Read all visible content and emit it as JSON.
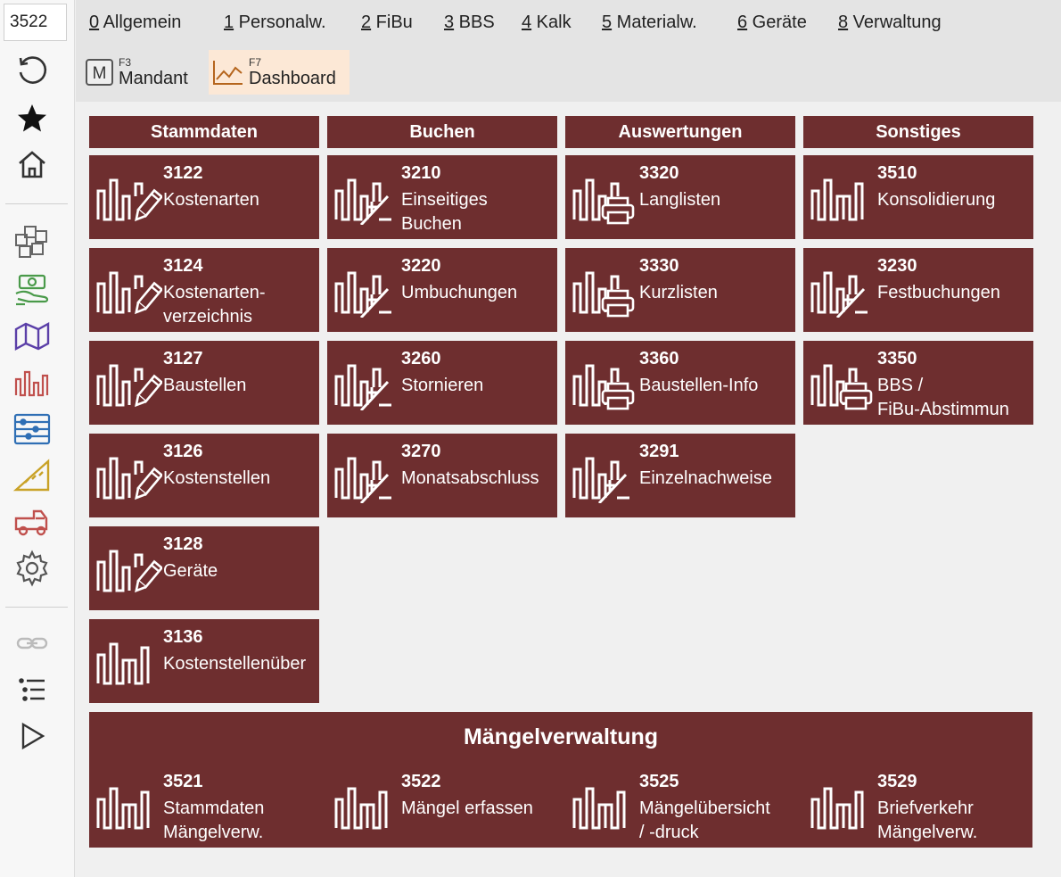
{
  "sidebar": {
    "code_input": "3522",
    "icons": [
      "refresh-icon",
      "star-icon",
      "home-icon",
      "modules-icon",
      "money-icon",
      "map-icon",
      "chart-icon",
      "abacus-icon",
      "stairs-icon",
      "truck-icon",
      "gear-icon",
      "link-icon",
      "list-icon",
      "play-icon"
    ]
  },
  "menu": {
    "items": [
      {
        "key": "0",
        "label": " Allgemein"
      },
      {
        "key": "1",
        "label": " Personalw."
      },
      {
        "key": "2",
        "label": " FiBu"
      },
      {
        "key": "3",
        "label": " BBS"
      },
      {
        "key": "4",
        "label": " Kalk"
      },
      {
        "key": "5",
        "label": " Materialw."
      },
      {
        "key": "6",
        "label": " Geräte"
      },
      {
        "key": "8",
        "label": " Verwaltung"
      }
    ]
  },
  "toolbar": {
    "mandant": {
      "key": "F3",
      "label": "Mandant",
      "icon_letter": "M"
    },
    "dashboard": {
      "key": "F7",
      "label": "Dashboard"
    }
  },
  "columns": [
    {
      "title": "Stammdaten",
      "tiles": [
        {
          "num": "3122",
          "name": "Kostenarten",
          "icon": "edit"
        },
        {
          "num": "3124",
          "name": "Kostenarten-\nverzeichnis",
          "icon": "edit"
        },
        {
          "num": "3127",
          "name": "Baustellen",
          "icon": "edit"
        },
        {
          "num": "3126",
          "name": "Kostenstellen",
          "icon": "edit"
        },
        {
          "num": "3128",
          "name": "Geräte",
          "icon": "edit"
        },
        {
          "num": "3136",
          "name": "Kostenstellenüber",
          "icon": "plain"
        }
      ]
    },
    {
      "title": "Buchen",
      "tiles": [
        {
          "num": "3210",
          "name": "Einseitiges\nBuchen",
          "icon": "plusminus"
        },
        {
          "num": "3220",
          "name": "Umbuchungen",
          "icon": "plusminus"
        },
        {
          "num": "3260",
          "name": "Stornieren",
          "icon": "plusminus"
        },
        {
          "num": "3270",
          "name": "Monatsabschluss",
          "icon": "plusminus"
        }
      ]
    },
    {
      "title": "Auswertungen",
      "tiles": [
        {
          "num": "3320",
          "name": "Langlisten",
          "icon": "print"
        },
        {
          "num": "3330",
          "name": "Kurzlisten",
          "icon": "print"
        },
        {
          "num": "3360",
          "name": "Baustellen-Info",
          "icon": "print"
        },
        {
          "num": "3291",
          "name": "Einzelnachweise",
          "icon": "plusminus"
        }
      ]
    },
    {
      "title": "Sonstiges",
      "tiles": [
        {
          "num": "3510",
          "name": "Konsolidierung",
          "icon": "plain"
        },
        {
          "num": "3230",
          "name": "Festbuchungen",
          "icon": "plusminus"
        },
        {
          "num": "3350",
          "name": "BBS /\nFiBu-Abstimmun",
          "icon": "print"
        }
      ]
    }
  ],
  "maengel": {
    "title": "Mängelverwaltung",
    "tiles": [
      {
        "num": "3521",
        "name": "Stammdaten\nMängelverw."
      },
      {
        "num": "3522",
        "name": "Mängel erfassen"
      },
      {
        "num": "3525",
        "name": "Mängelübersicht\n/ -druck"
      },
      {
        "num": "3529",
        "name": "Briefverkehr\nMängelverw."
      }
    ]
  },
  "colors": {
    "tile": "#6e2e2f",
    "topbar": "#e4e4e4",
    "dashboard_highlight": "#fce8d6"
  }
}
